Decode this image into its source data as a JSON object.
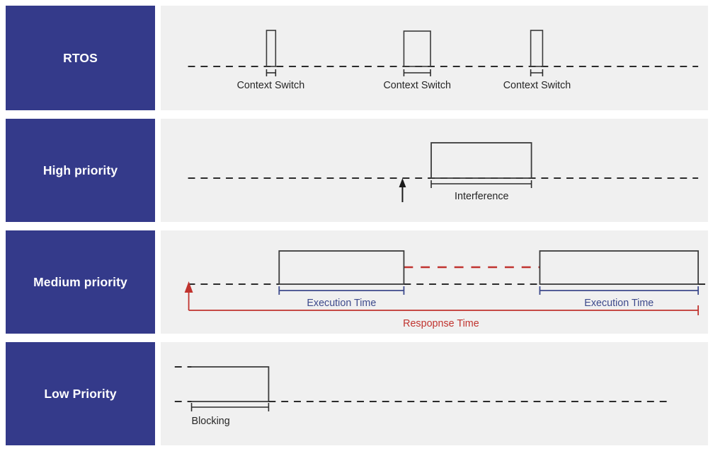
{
  "diagram": {
    "title_visible": false,
    "background": "#ffffff",
    "panel_bg": "#f0f0f0",
    "label_bg": "#343a8a",
    "label_fg": "#ffffff",
    "line_color": "#3a3a3a",
    "blue_accent": "#3d4a8c",
    "red_accent": "#c0332e"
  },
  "rows": [
    {
      "id": "rtos",
      "label": "RTOS",
      "annotations": [
        {
          "name": "context-switch-1",
          "text": "Context Switch"
        },
        {
          "name": "context-switch-2",
          "text": "Context Switch"
        },
        {
          "name": "context-switch-3",
          "text": "Context Switch"
        }
      ]
    },
    {
      "id": "high-priority",
      "label": "High priority",
      "annotations": [
        {
          "name": "interference",
          "text": "Interference"
        }
      ]
    },
    {
      "id": "medium-priority",
      "label": "Medium priority",
      "annotations": [
        {
          "name": "execution-time-1",
          "text": "Execution Time"
        },
        {
          "name": "execution-time-2",
          "text": "Execution Time"
        },
        {
          "name": "response-time",
          "text": "Respopnse Time"
        }
      ]
    },
    {
      "id": "low-priority",
      "label": "Low Priority",
      "annotations": [
        {
          "name": "blocking",
          "text": "Blocking"
        }
      ]
    }
  ]
}
